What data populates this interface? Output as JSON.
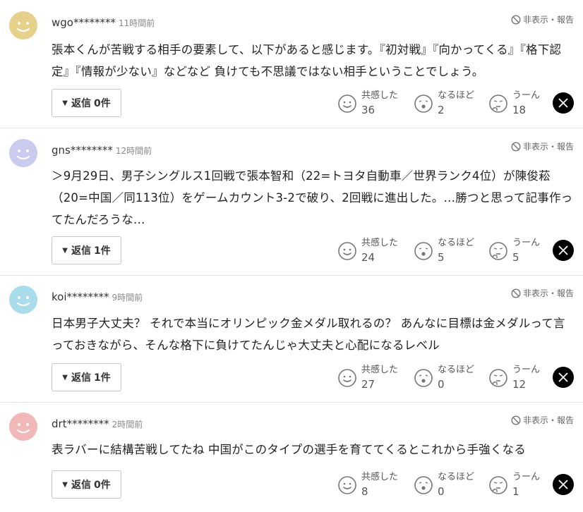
{
  "comments": [
    {
      "username": "wgo********",
      "time": "11時間前",
      "avatar_color": "#e6d18a",
      "hide_label": "非表示・報告",
      "text": "張本くんが苦戦する相手の要素して、以下があると感じます。『初対戦』『向かってくる』『格下認定』『情報が少ない』などなど 負けても不思議ではない相手ということでしょう。",
      "reply_label": "返信",
      "reply_count": "0件",
      "reactions": {
        "empathy_label": "共感した",
        "empathy_count": "36",
        "naruhodo_label": "なるほど",
        "naruhodo_count": "2",
        "uun_label": "うーん",
        "uun_count": "18"
      }
    },
    {
      "username": "gns********",
      "time": "12時間前",
      "avatar_color": "#c9ccee",
      "hide_label": "非表示・報告",
      "text": "＞9月29日、男子シングルス1回戦で張本智和（22=トヨタ自動車／世界ランク4位）が陳俊菘（20=中国／同113位）をゲームカウント3-2で破り、2回戦に進出した。…勝つと思って記事作ってたんだろうな…",
      "reply_label": "返信",
      "reply_count": "1件",
      "reactions": {
        "empathy_label": "共感した",
        "empathy_count": "24",
        "naruhodo_label": "なるほど",
        "naruhodo_count": "5",
        "uun_label": "うーん",
        "uun_count": "5"
      }
    },
    {
      "username": "koi********",
      "time": "9時間前",
      "avatar_color": "#a9dcea",
      "hide_label": "非表示・報告",
      "text": "日本男子大丈夫？ それで本当にオリンピック金メダル取れるの？ あんなに目標は金メダルって言っておきながら、そんな格下に負けてたんじゃ大丈夫と心配になるレベル",
      "reply_label": "返信",
      "reply_count": "1件",
      "reactions": {
        "empathy_label": "共感した",
        "empathy_count": "27",
        "naruhodo_label": "なるほど",
        "naruhodo_count": "0",
        "uun_label": "うーん",
        "uun_count": "12"
      }
    },
    {
      "username": "drt********",
      "time": "2時間前",
      "avatar_color": "#f2b8b8",
      "hide_label": "非表示・報告",
      "text": "表ラバーに結構苦戦してたね 中国がこのタイプの選手を育ててくるとこれから手強くなる",
      "reply_label": "返信",
      "reply_count": "0件",
      "reactions": {
        "empathy_label": "共感した",
        "empathy_count": "8",
        "naruhodo_label": "なるほど",
        "naruhodo_count": "0",
        "uun_label": "うーん",
        "uun_count": "1"
      }
    }
  ],
  "icons": {
    "avatar": "smiley-face-icon",
    "hide": "prohibited-icon",
    "reply_toggle": "triangle-down-icon",
    "empathy": "smile-icon",
    "naruhodo": "surprised-face-icon",
    "uun": "thinking-face-icon",
    "share": "x-logo-icon"
  }
}
